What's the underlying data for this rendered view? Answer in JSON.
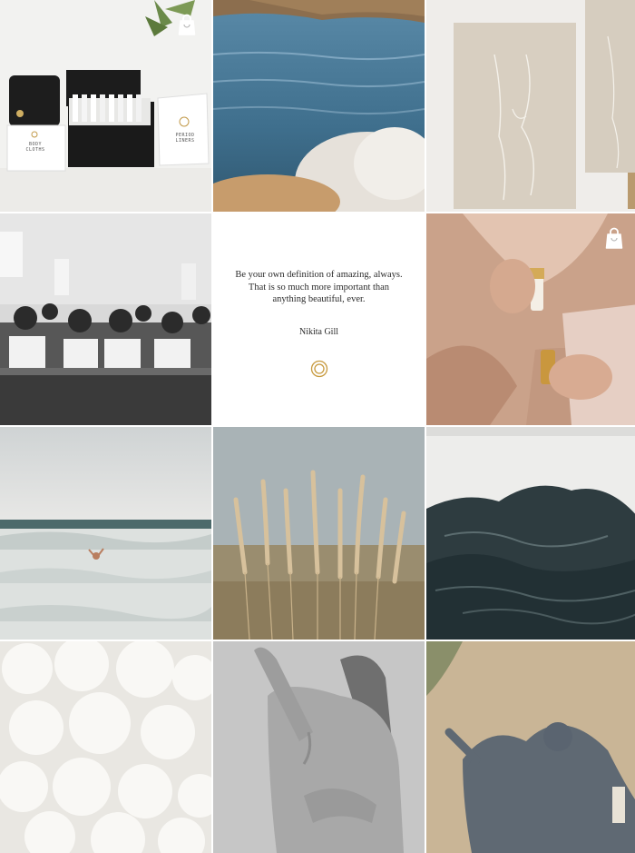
{
  "feed": {
    "tiles": [
      {
        "name": "tile-products",
        "shop_icon": "shopping-bag-icon"
      },
      {
        "name": "tile-sea-rocks"
      },
      {
        "name": "tile-canvas-art"
      },
      {
        "name": "tile-classroom"
      },
      {
        "name": "tile-quote",
        "quote_lines": [
          "Be your own definition of amazing, always.",
          "That is so much more important than",
          "anything beautiful, ever."
        ],
        "author": "Nikita Gill",
        "logo_icon": "brand-rings-icon"
      },
      {
        "name": "tile-oil-bottles",
        "shop_icon": "shopping-bag-icon"
      },
      {
        "name": "tile-ocean-swimmer"
      },
      {
        "name": "tile-pampas-grass"
      },
      {
        "name": "tile-wave-room"
      },
      {
        "name": "tile-cotton"
      },
      {
        "name": "tile-back-figure"
      },
      {
        "name": "tile-shadow-rock"
      }
    ],
    "product_labels": {
      "left_box": "BODY\nCLOTHS",
      "right_box": "PERIOD\nLINERS"
    }
  }
}
